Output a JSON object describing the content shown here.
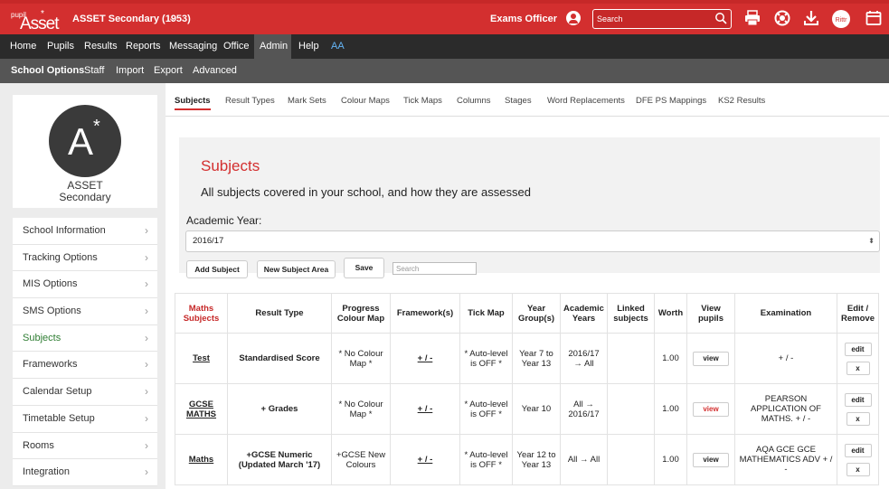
{
  "app": {
    "logo_small": "pupil",
    "logo_main": "Asset",
    "logo_star": "*",
    "school_name": "ASSET Secondary (1953)",
    "user_role": "Exams Officer",
    "search_placeholder": "Search",
    "top_icons": [
      "print-icon",
      "support-icon",
      "download-icon",
      "ritter-icon",
      "calendar-icon"
    ]
  },
  "main_nav": [
    "Home",
    "Pupils",
    "Results",
    "Reports",
    "Messaging",
    "Office",
    "Admin",
    "Help",
    "AA"
  ],
  "main_nav_active": "Admin",
  "sub_nav": [
    "School Options",
    "Staff",
    "Import",
    "Export",
    "Advanced"
  ],
  "sub_nav_active": "School Options",
  "sidebar": {
    "avatar_letter": "A",
    "avatar_star": "*",
    "school_line1": "ASSET",
    "school_line2": "Secondary",
    "items": [
      {
        "label": "School Information"
      },
      {
        "label": "Tracking Options"
      },
      {
        "label": "MIS Options"
      },
      {
        "label": "SMS Options"
      },
      {
        "label": "Subjects"
      },
      {
        "label": "Frameworks"
      },
      {
        "label": "Calendar Setup"
      },
      {
        "label": "Timetable Setup"
      },
      {
        "label": "Rooms"
      },
      {
        "label": "Integration"
      }
    ],
    "active_item": "Subjects"
  },
  "tabs": [
    "Subjects",
    "Result Types",
    "Mark Sets",
    "Colour Maps",
    "Tick Maps",
    "Columns",
    "Stages",
    "Word Replacements",
    "DFE PS Mappings",
    "KS2 Results"
  ],
  "active_tab": "Subjects",
  "panel": {
    "title": "Subjects",
    "description": "All subjects covered in your school, and how they are assessed"
  },
  "academic_year": {
    "label": "Academic Year:",
    "value": "2016/17"
  },
  "buttons": {
    "add_subject": "Add Subject",
    "new_subject_area": "New Subject Area",
    "save": "Save"
  },
  "table_search_placeholder": "Search",
  "table": {
    "headers": [
      "Maths Subjects",
      "Result Type",
      "Progress Colour Map",
      "Framework(s)",
      "Tick Map",
      "Year Group(s)",
      "Academic Years",
      "Linked subjects",
      "Worth",
      "View pupils",
      "Examination",
      "Edit / Remove"
    ],
    "rows": [
      {
        "subject": "Test",
        "result_type": "Standardised Score",
        "colour_map": "* No Colour Map *",
        "framework": "+ / -",
        "tick_map": "* Auto-level is OFF *",
        "year_groups": "Year 7 to Year 13",
        "academic_years": "2016/17 → All",
        "linked": "",
        "worth": "1.00",
        "view": "view",
        "view_red": false,
        "examination": "+ / -",
        "edit": "edit",
        "remove": "x"
      },
      {
        "subject": "GCSE MATHS",
        "result_type": "+ Grades",
        "colour_map": "* No Colour Map *",
        "framework": "+ / -",
        "tick_map": "* Auto-level is OFF *",
        "year_groups": "Year 10",
        "academic_years": "All → 2016/17",
        "linked": "",
        "worth": "1.00",
        "view": "view",
        "view_red": true,
        "examination": "PEARSON APPLICATION OF MATHS. + / -",
        "edit": "edit",
        "remove": "x"
      },
      {
        "subject": "Maths",
        "result_type": "+GCSE Numeric (Updated March '17)",
        "colour_map": "+GCSE New Colours",
        "framework": "+ / -",
        "tick_map": "* Auto-level is OFF *",
        "year_groups": "Year 12 to Year 13",
        "academic_years": "All → All",
        "linked": "",
        "worth": "1.00",
        "view": "view",
        "view_red": false,
        "examination": "AQA GCE GCE MATHEMATICS ADV + / -",
        "edit": "edit",
        "remove": "x"
      }
    ]
  },
  "colors": {
    "brand_red": "#d32f2f",
    "nav_dark": "#2b2b2b",
    "subnav_grey": "#555555",
    "active_sidebar": "#2e7d32",
    "aa_link": "#64b5f6"
  }
}
